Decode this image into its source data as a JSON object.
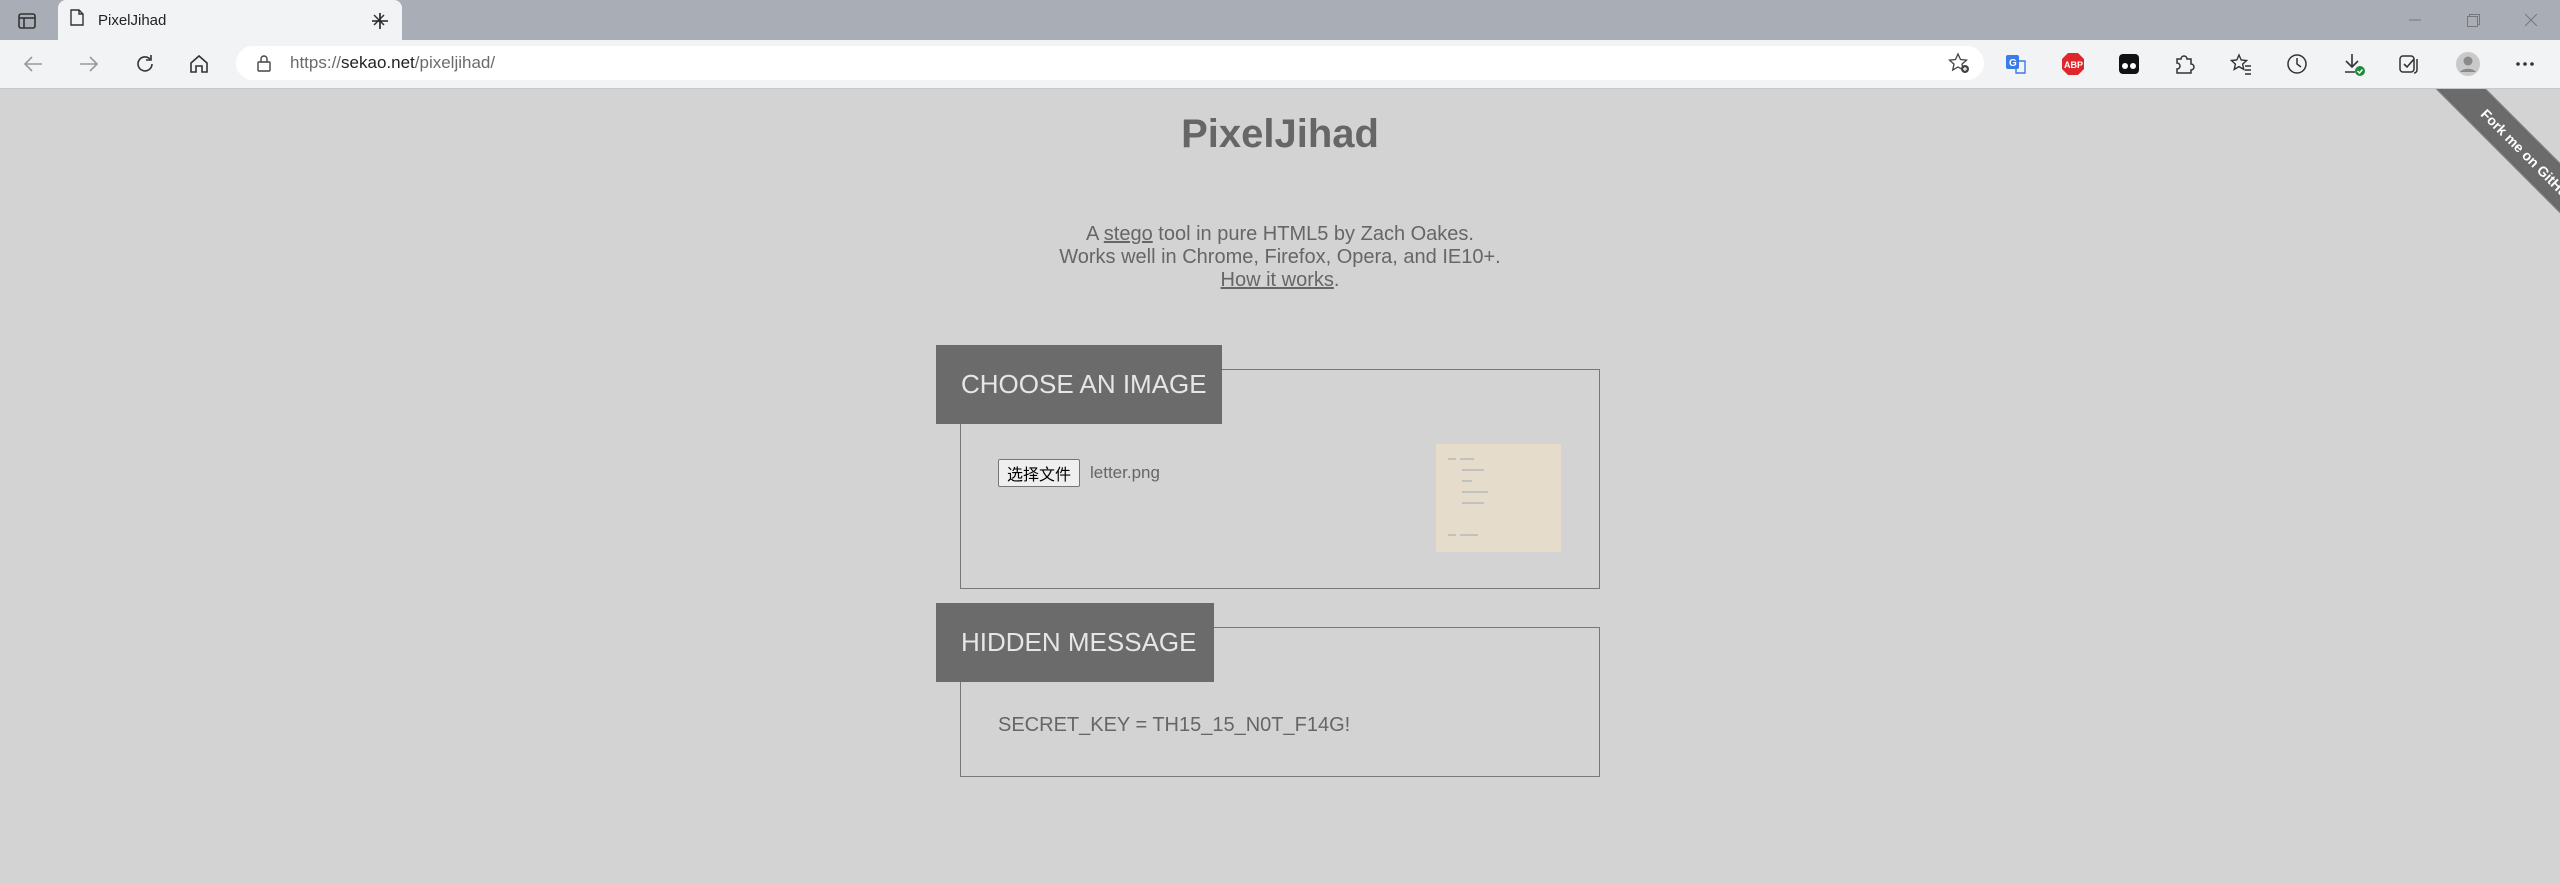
{
  "browser": {
    "tab_title": "PixelJihad",
    "url_prefix": "https://",
    "url_host": "sekao.net",
    "url_path": "/pixeljihad/",
    "extensions": [
      "translate-icon",
      "adblock-icon",
      "tampermonkey-icon",
      "puzzle-extensions-icon",
      "favorites-icon",
      "history-icon",
      "downloads-icon",
      "collections-icon",
      "profile-avatar",
      "more-icon"
    ],
    "adblock_label": "ABP"
  },
  "page": {
    "title": "PixelJihad",
    "intro_line1_prefix": "A ",
    "intro_line1_link": "stego",
    "intro_line1_suffix": " tool in pure HTML5 by Zach Oakes.",
    "intro_line2": "Works well in Chrome, Firefox, Opera, and IE10+.",
    "intro_line3_link": "How it works",
    "intro_line3_suffix": ".",
    "ribbon": "Fork me on GitHub"
  },
  "image_section": {
    "label": "CHOOSE AN IMAGE",
    "file_button": "选择文件",
    "file_name": "letter.png"
  },
  "message_section": {
    "label": "HIDDEN MESSAGE",
    "text": "SECRET_KEY = TH15_15_N0T_F14G!"
  },
  "colors": {
    "page_bg": "#d3d3d3",
    "label_bg": "#6b6b6b",
    "text": "#666666"
  }
}
